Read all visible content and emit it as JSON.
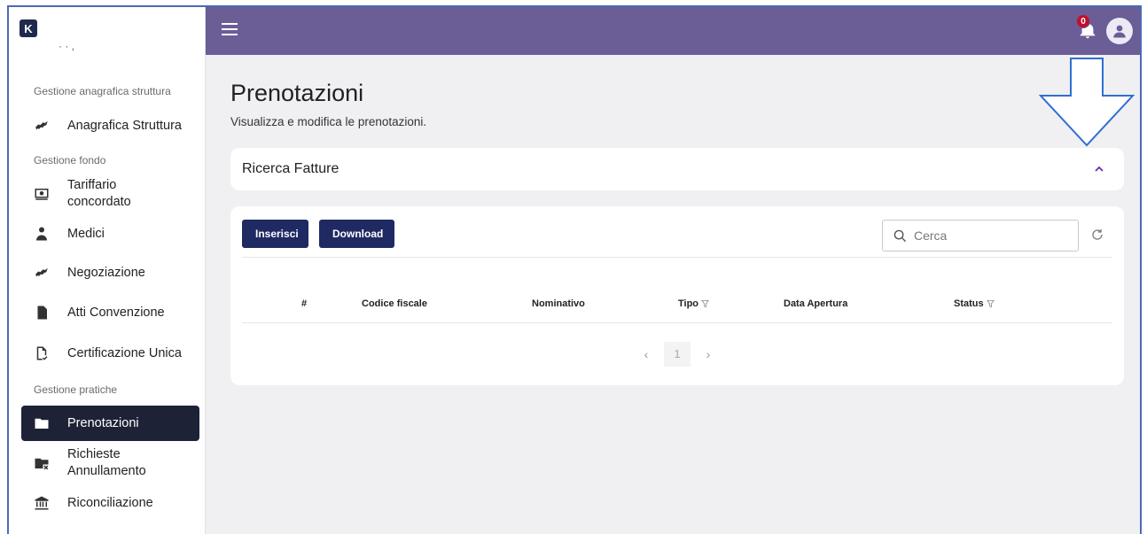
{
  "app": {
    "logo_letter": "K"
  },
  "sidebar": {
    "cut_text": "· ·   ,",
    "sections": [
      {
        "label": "Gestione anagrafica struttura"
      },
      {
        "label": "Gestione fondo"
      },
      {
        "label": "Gestione pratiche"
      }
    ],
    "items": [
      {
        "label": "Anagrafica Struttura",
        "icon": "handshake-icon"
      },
      {
        "label_line1": "Tariffario",
        "label_line2": "concordato",
        "icon": "money-icon"
      },
      {
        "label": "Medici",
        "icon": "doctor-icon"
      },
      {
        "label": "Negoziazione",
        "icon": "handshake-icon"
      },
      {
        "label": "Atti Convenzione",
        "icon": "document-icon"
      },
      {
        "label": "Certificazione Unica",
        "icon": "document-check-icon"
      },
      {
        "label": "Prenotazioni",
        "icon": "folder-icon",
        "active": true
      },
      {
        "label_line1": "Richieste",
        "label_line2": "Annullamento",
        "icon": "folder-cancel-icon"
      },
      {
        "label": "Riconciliazione",
        "icon": "bank-icon"
      }
    ]
  },
  "topbar": {
    "notification_count": "0",
    "bg_color": "#6b5d96"
  },
  "main": {
    "title": "Prenotazioni",
    "subtitle": "Visualizza e modifica le prenotazioni.",
    "search_card_title": "Ricerca Fatture",
    "buttons": {
      "insert": "Inserisci",
      "download": "Download"
    },
    "search": {
      "placeholder": "Cerca"
    },
    "table": {
      "columns": [
        "#",
        "Codice fiscale",
        "Nominativo",
        "Tipo",
        "Data Apertura",
        "Status"
      ]
    },
    "pagination": {
      "current_page": "1",
      "prev": "‹",
      "next": "›"
    }
  }
}
